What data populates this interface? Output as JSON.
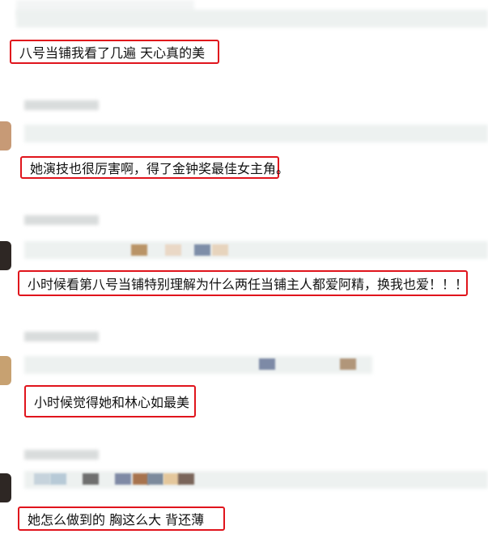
{
  "comments": [
    {
      "text": "八号当铺我看了几遍 天心真的美"
    },
    {
      "text": "她演技也很厉害啊，得了金钟奖最佳女主角。"
    },
    {
      "text": "小时候看第八号当铺特别理解为什么两任当铺主人都爱阿精，换我也爱！！！"
    },
    {
      "text": "小时候觉得她和林心如最美"
    },
    {
      "text": "她怎么做到的 胸这么大 背还薄"
    }
  ]
}
